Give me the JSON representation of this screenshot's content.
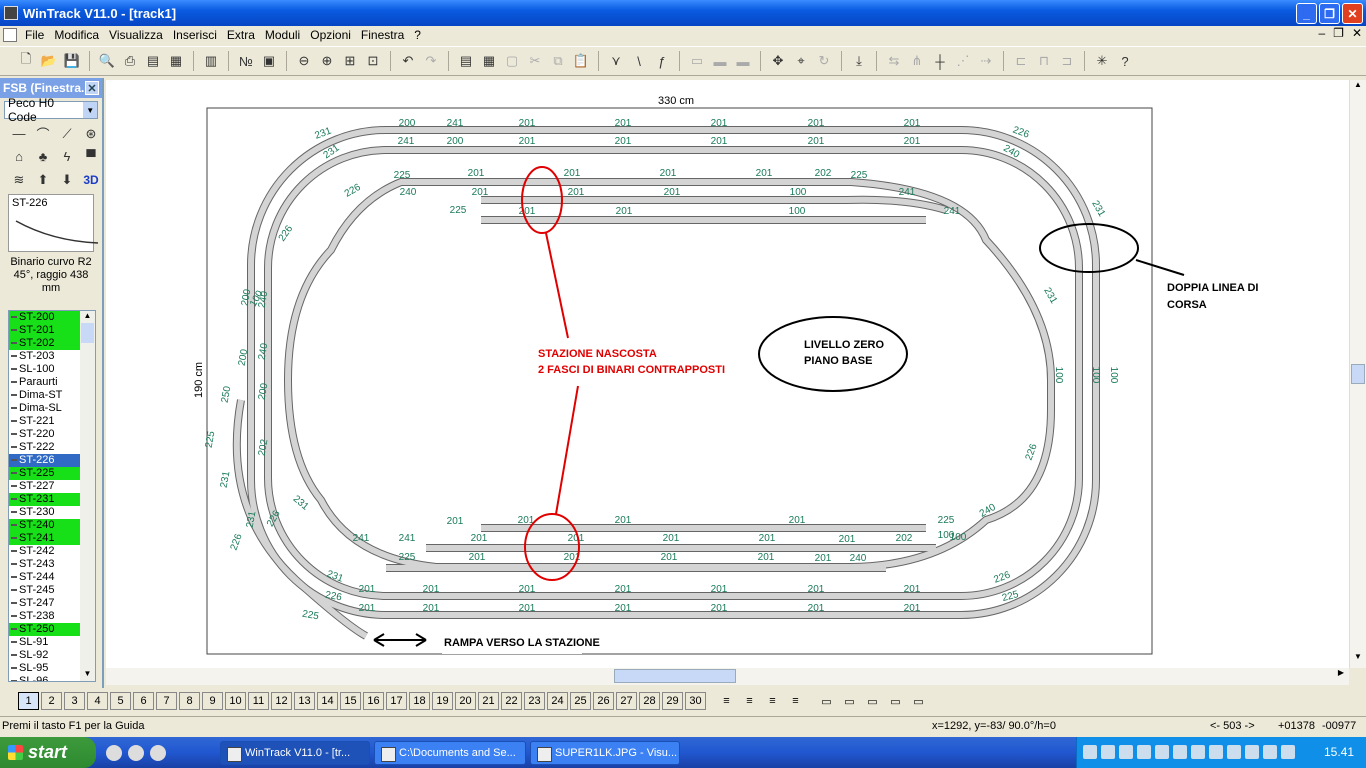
{
  "window": {
    "title": "WinTrack  V11.0 - [track1]"
  },
  "menu": [
    "File",
    "Modifica",
    "Visualizza",
    "Inserisci",
    "Extra",
    "Moduli",
    "Opzioni",
    "Finestra",
    "?"
  ],
  "panel": {
    "title": "FSB (Finestra...",
    "library": "Peco H0 Code",
    "preview_label": "ST-226",
    "description": "Binario curvo R2 45°, raggio 438 mm",
    "tool_3d": "3D",
    "items": [
      {
        "label": "ST-200",
        "state": "g"
      },
      {
        "label": "ST-201",
        "state": "g"
      },
      {
        "label": "ST-202",
        "state": "g"
      },
      {
        "label": "ST-203",
        "state": ""
      },
      {
        "label": "SL-100",
        "state": ""
      },
      {
        "label": "Paraurti",
        "state": ""
      },
      {
        "label": "Dima-ST",
        "state": ""
      },
      {
        "label": "Dima-SL",
        "state": ""
      },
      {
        "label": "ST-221",
        "state": ""
      },
      {
        "label": "ST-220",
        "state": ""
      },
      {
        "label": "ST-222",
        "state": ""
      },
      {
        "label": "ST-226",
        "state": "b"
      },
      {
        "label": "ST-225",
        "state": "g"
      },
      {
        "label": "ST-227",
        "state": ""
      },
      {
        "label": "ST-231",
        "state": "g"
      },
      {
        "label": "ST-230",
        "state": ""
      },
      {
        "label": "ST-240",
        "state": "g"
      },
      {
        "label": "ST-241",
        "state": "g"
      },
      {
        "label": "ST-242",
        "state": ""
      },
      {
        "label": "ST-243",
        "state": ""
      },
      {
        "label": "ST-244",
        "state": ""
      },
      {
        "label": "ST-245",
        "state": ""
      },
      {
        "label": "ST-247",
        "state": ""
      },
      {
        "label": "ST-238",
        "state": ""
      },
      {
        "label": "ST-250",
        "state": "g"
      },
      {
        "label": "SL-91",
        "state": ""
      },
      {
        "label": "SL-92",
        "state": ""
      },
      {
        "label": "SL-95",
        "state": ""
      },
      {
        "label": "SL-96",
        "state": ""
      }
    ]
  },
  "canvas": {
    "dim_width": "330 cm",
    "dim_height": "190 cm",
    "annotation_station_1": "STAZIONE NASCOSTA",
    "annotation_station_2": "2 FASCI DI BINARI CONTRAPPOSTI",
    "annotation_double_1": "DOPPIA LINEA DI",
    "annotation_double_2": "CORSA",
    "annotation_level_1": "LIVELLO ZERO",
    "annotation_level_2": "PIANO BASE",
    "annotation_ramp": "RAMPA VERSO LA STAZIONE",
    "track_labels": {
      "top_outer": [
        "200",
        "241",
        "201",
        "201",
        "201",
        "201",
        "201"
      ],
      "top_inner": [
        "241",
        "200",
        "201",
        "201",
        "201",
        "201",
        "201"
      ],
      "st_a": [
        "225",
        "201",
        "201",
        "201",
        "201",
        "202",
        "225"
      ],
      "st_b": [
        "240",
        "201",
        "201",
        "201",
        "100",
        "241"
      ],
      "st_c": [
        "225",
        "201",
        "201",
        "100",
        "241"
      ],
      "corners": [
        "231",
        "231",
        "226",
        "226",
        "240",
        "231",
        "100",
        "226",
        "200",
        "240",
        "200",
        "240",
        "250",
        "200",
        "225",
        "202",
        "231",
        "231",
        "226",
        "226",
        "231",
        "231",
        "226",
        "225",
        "226",
        "225",
        "231",
        "240",
        "226"
      ],
      "right": [
        "100",
        "100",
        "100"
      ],
      "bot_a": [
        "201",
        "201",
        "201",
        "201",
        "100",
        "100"
      ],
      "bot_b": [
        "241",
        "201",
        "201",
        "201",
        "201",
        "201",
        "202",
        "225",
        "240"
      ],
      "bot_c": [
        "225",
        "201",
        "201",
        "201",
        "201",
        "201",
        "241"
      ],
      "bot_outer": [
        "201",
        "201",
        "201",
        "201",
        "201",
        "201",
        "201"
      ],
      "bot_inner": [
        "201",
        "201",
        "201",
        "201",
        "201",
        "201",
        "201"
      ]
    }
  },
  "pages": [
    "1",
    "2",
    "3",
    "4",
    "5",
    "6",
    "7",
    "8",
    "9",
    "10",
    "11",
    "12",
    "13",
    "14",
    "15",
    "16",
    "17",
    "18",
    "19",
    "20",
    "21",
    "22",
    "23",
    "24",
    "25",
    "26",
    "27",
    "28",
    "29",
    "30"
  ],
  "status": {
    "help": "Premi il tasto F1 per la Guida",
    "coords": "x=1292, y=-83/ 90.0°/h=0",
    "count": "<- 503 ->",
    "x": "+01378",
    "y": "-00977"
  },
  "taskbar": {
    "start": "start",
    "tasks": [
      "WinTrack  V11.0 - [tr...",
      "C:\\Documents and Se...",
      "SUPER1LK.JPG - Visu..."
    ],
    "clock": "15.41"
  }
}
